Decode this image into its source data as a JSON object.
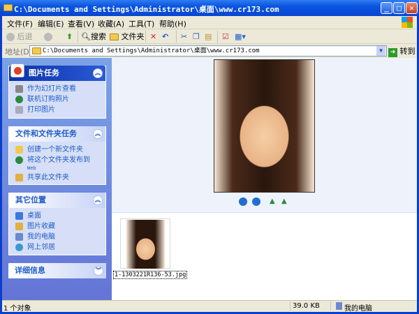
{
  "window": {
    "title": "C:\\Documents and Settings\\Administrator\\桌面\\www.cr173.com",
    "minimize": "_",
    "maximize": "□",
    "close": "✕"
  },
  "menu": [
    "文件(F)",
    "编辑(E)",
    "查看(V)",
    "收藏(A)",
    "工具(T)",
    "帮助(H)"
  ],
  "toolbar": {
    "back": "后退",
    "search": "搜索",
    "folders": "文件夹"
  },
  "address": {
    "label": "地址(D)",
    "value": "C:\\Documents and Settings\\Administrator\\桌面\\www.cr173.com",
    "go": "转到"
  },
  "sidebar": {
    "picture_tasks": {
      "title": "图片任务",
      "items": [
        "作为幻灯片查看",
        "联机订购照片",
        "打印图片"
      ]
    },
    "file_tasks": {
      "title": "文件和文件夹任务",
      "items": [
        "创建一个新文件夹",
        "将这个文件夹发布到",
        "共享此文件夹"
      ],
      "publish_sub": "Web"
    },
    "other_places": {
      "title": "其它位置",
      "items": [
        "桌面",
        "图片收藏",
        "我的电脑",
        "网上邻居"
      ]
    },
    "details": {
      "title": "详细信息"
    }
  },
  "file": {
    "name": "1-1303221R136-53.jpg"
  },
  "status": {
    "objects": "1 个对象",
    "size": "39.0 KB",
    "location": "我的电脑"
  },
  "colors": {
    "title_bar": "#0a54e0",
    "link": "#215dc6",
    "chrome": "#ece9d8"
  }
}
